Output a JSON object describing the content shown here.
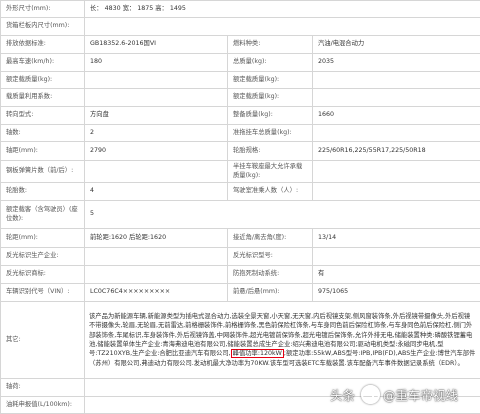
{
  "rows": [
    {
      "label": "外形尺寸(mm):",
      "value": "长： 4830 宽： 1875 高： 1495"
    },
    {
      "label": "货箱栏板内尺寸(mm):",
      "value": ""
    },
    {
      "left": {
        "label": "排放依据标准:",
        "value": "GB18352.6-2016国VI"
      },
      "right": {
        "label": "燃料种类:",
        "value": "汽油/电混合动力"
      }
    },
    {
      "left": {
        "label": "最高车速(km/h):",
        "value": "180"
      },
      "right": {
        "label": "总质量(kg):",
        "value": "2035"
      }
    },
    {
      "left": {
        "label": "额定载质量(kg):",
        "value": ""
      },
      "right": {
        "label": "额定载质量(kg):",
        "value": ""
      }
    },
    {
      "left": {
        "label": "载质量利用系数:",
        "value": ""
      },
      "right": {
        "label": "额定载质量(kg):",
        "value": ""
      }
    },
    {
      "left": {
        "label": "转向型式:",
        "value": "方向盘"
      },
      "right": {
        "label": "整备质量(kg):",
        "value": "1660"
      }
    },
    {
      "left": {
        "label": "轴数:",
        "value": "2"
      },
      "right": {
        "label": "准拖挂车总质量(kg):",
        "value": ""
      }
    },
    {
      "left": {
        "label": "轴距(mm):",
        "value": "2790"
      },
      "right": {
        "label": "轮胎规格:",
        "value": "225/60R16,225/55R17,225/50R18"
      }
    },
    {
      "left": {
        "label": "钢板弹簧片数（前/后）:",
        "value": ""
      },
      "right": {
        "label": "半挂车鞍座最大允许承载质量(kg):",
        "value": ""
      }
    },
    {
      "left": {
        "label": "轮胎数:",
        "value": "4"
      },
      "right": {
        "label": "驾驶室准乘人数（人）:",
        "value": ""
      }
    },
    {
      "left": {
        "label": "额定载客（含驾驶员）(座位数):",
        "value": "5"
      },
      "right": null
    },
    {
      "left": {
        "label": "轮距(mm):",
        "value": "前轮距:1620 后轮距:1620"
      },
      "right": {
        "label": "接近角/离去角(度):",
        "value": "13/14"
      }
    },
    {
      "left": {
        "label": "反光标识生产企业:",
        "value": ""
      },
      "right": {
        "label": "反光标识型号:",
        "value": ""
      }
    },
    {
      "left": {
        "label": "反光标识商标:",
        "value": ""
      },
      "right": {
        "label": "防抱死制动系统:",
        "value": "有"
      }
    },
    {
      "left": {
        "label": "车辆识别代号（VIN）:",
        "value": "LC0C76C4×××××××××"
      },
      "right": {
        "label": "前悬/后悬(mm):",
        "value": "975/1065"
      }
    }
  ],
  "other": {
    "label": "其它:",
    "text_before": "该产品为新能源车辆,新能源类型为插电式混合动力,选装全景天窗,小天窗,无天窗,内后视镜支架,侧风窗装饰条,外后视镜带摄像头,外后视镜不带摄像头,轮眉,无轮眉,无前雷达,前格栅装饰件,前格栅饰条,黑色前保险杠饰条,与车身同色前后保险杠饰条,与车身同色前后保险杠,侧门外部装饰条,车尾标识,车身装饰件,外后视镜饰盖,中网装饰件,超光电镀前保饰条,超光电镀后保饰条,允许外排无电,储能装置种类:磷酸铁锂蓄电池,储能装置单体生产企业:青海弗迪电池有限公司,储能装置总成生产企业:绍兴弗迪电池有限公司;驱动电机类型:永磁同步电机,型号:TZ210XYB,生产企业:合肥比亚迪汽车有限公司,",
    "highlight": "峰值功率:120kW",
    "text_after": ";额定功率:55kW,ABS型号:IPB,IPB(FD),ABS生产企业:博世汽车部件（苏州）有限公司,弗迪动力有限公司.发动机最大净功率为70KW.该车型可选装ETC车载装置.该车配备汽车事件数据记录系统（EDR）。"
  },
  "single_rows_bottom": [
    {
      "label": "轴荷:",
      "value": ""
    },
    {
      "label": "油耗申报值(L/100km):",
      "value": ""
    }
  ],
  "watermark": {
    "prefix": "头条",
    "author": "@重车帝视线"
  }
}
